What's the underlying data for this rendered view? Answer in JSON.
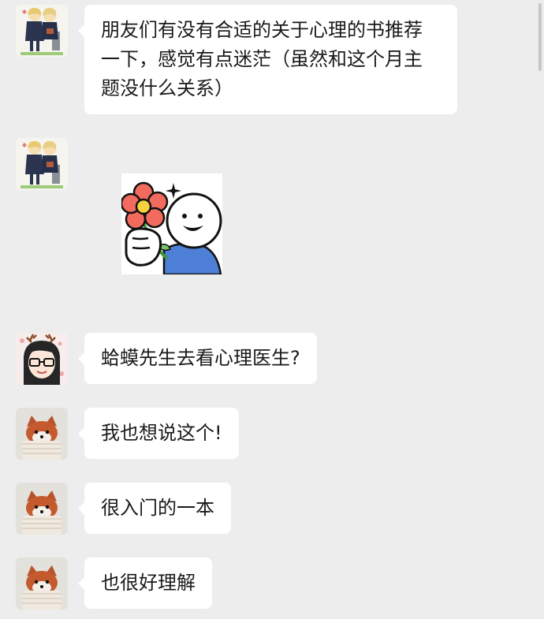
{
  "messages": [
    {
      "sender": "anime-couple-avatar",
      "type": "text",
      "text": "朋友们有没有合适的关于心理的书推荐一下，感觉有点迷茫（虽然和这个月主题没什么关系）"
    },
    {
      "sender": "anime-couple-avatar",
      "type": "sticker",
      "sticker_icon": "flower-smiley-sticker"
    },
    {
      "sender": "glasses-girl-avatar",
      "type": "text",
      "text": "蛤蟆先生去看心理医生?"
    },
    {
      "sender": "red-panda-avatar",
      "type": "text",
      "text": "我也想说这个!"
    },
    {
      "sender": "red-panda-avatar",
      "type": "text",
      "text": "很入门的一本"
    },
    {
      "sender": "red-panda-avatar",
      "type": "text",
      "text": "也很好理解"
    }
  ],
  "colors": {
    "background": "#ededed",
    "bubble": "#ffffff",
    "text": "#1a1a1a"
  }
}
